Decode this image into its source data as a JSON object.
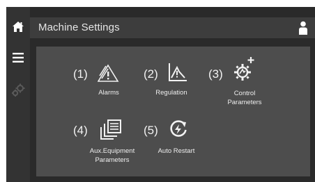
{
  "header": {
    "title": "Machine Settings"
  },
  "sidebar": {
    "items": [
      {
        "icon": "home-icon"
      },
      {
        "icon": "hamburger-menu-icon"
      },
      {
        "icon": "gears-icon"
      }
    ]
  },
  "menu": {
    "items": [
      {
        "number": "(1)",
        "label": "Alarms",
        "icon": "alarm-triangle-icon"
      },
      {
        "number": "(2)",
        "label": "Regulation",
        "icon": "regulation-chart-icon"
      },
      {
        "number": "(3)",
        "label_line1": "Control",
        "label_line2": "Parameters",
        "icon": "control-gear-plus-icon"
      },
      {
        "number": "(4)",
        "label_line1": "Aux.Equipment",
        "label_line2": "Parameters",
        "icon": "stacked-documents-icon"
      },
      {
        "number": "(5)",
        "label": "Auto Restart",
        "icon": "auto-restart-icon"
      }
    ]
  },
  "colors": {
    "background": "#2a2a2a",
    "sidebar": "#333333",
    "topbar": "#3d3d3d",
    "panel": "#4d4d4d",
    "text": "#f2f2f2"
  }
}
